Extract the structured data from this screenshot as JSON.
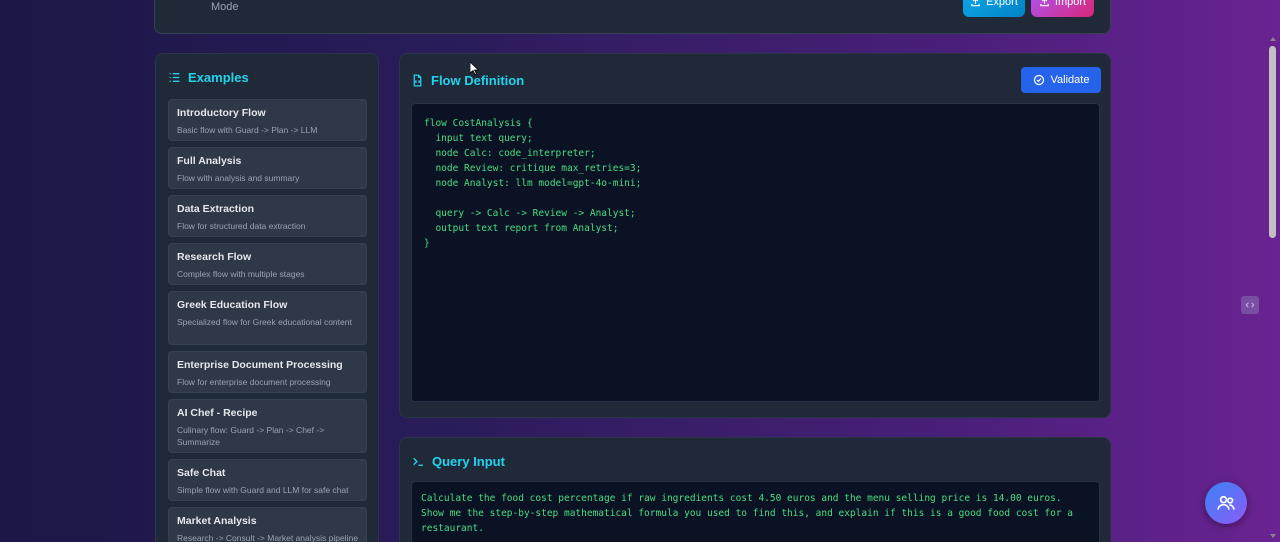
{
  "header": {
    "mode_text": "Mode",
    "export_label": "Export",
    "import_label": "Import"
  },
  "sidebar": {
    "title": "Examples",
    "items": [
      {
        "title": "Introductory Flow",
        "desc": "Basic flow with Guard -> Plan -> LLM"
      },
      {
        "title": "Full Analysis",
        "desc": "Flow with analysis and summary"
      },
      {
        "title": "Data Extraction",
        "desc": "Flow for structured data extraction"
      },
      {
        "title": "Research Flow",
        "desc": "Complex flow with multiple stages"
      },
      {
        "title": "Greek Education Flow",
        "desc": "Specialized flow for Greek educational content"
      },
      {
        "title": "Enterprise Document Processing",
        "desc": "Flow for enterprise document processing"
      },
      {
        "title": "AI Chef - Recipe",
        "desc": "Culinary flow: Guard -> Plan -> Chef -> Summarize"
      },
      {
        "title": "Safe Chat",
        "desc": "Simple flow with Guard and LLM for safe chat"
      },
      {
        "title": "Market Analysis",
        "desc": "Research -> Consult -> Market analysis pipeline"
      }
    ]
  },
  "flow_panel": {
    "title": "Flow Definition",
    "validate_label": "Validate",
    "code": "flow CostAnalysis {\n  input text query;\n  node Calc: code_interpreter;\n  node Review: critique max_retries=3;\n  node Analyst: llm model=gpt-4o-mini;\n\n  query -> Calc -> Review -> Analyst;\n  output text report from Analyst;\n}"
  },
  "query_panel": {
    "title": "Query Input",
    "text": "Calculate the food cost percentage if raw ingredients cost 4.50 euros and the menu selling price is 14.00 euros. Show me the step-by-step mathematical formula you used to find this, and explain if this is a good food cost for a restaurant."
  },
  "icons": {
    "export": "upload-icon",
    "import": "upload-icon",
    "examples": "list-icon",
    "flow": "file-code-icon",
    "validate": "check-circle-icon",
    "query": "terminal-icon",
    "fab": "users-icon"
  },
  "colors": {
    "accent": "#22d3ee",
    "code": "#4ade80",
    "validate": "#2563eb"
  }
}
